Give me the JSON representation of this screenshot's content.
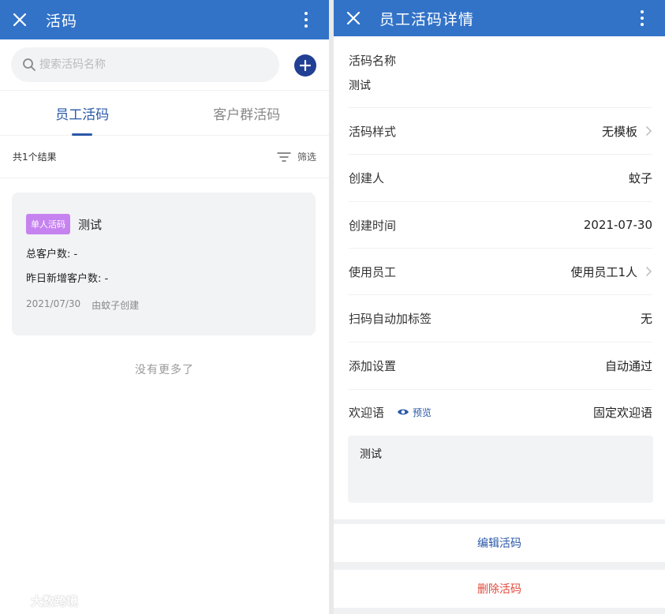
{
  "left": {
    "title": "活码",
    "search": {
      "placeholder": "搜索活码名称",
      "value": ""
    },
    "tabs": [
      {
        "label": "员工活码",
        "active": true
      },
      {
        "label": "客户群活码",
        "active": false
      }
    ],
    "result_count": "共1个结果",
    "filter_label": "筛选",
    "card": {
      "badge": "单人活码",
      "title": "测试",
      "total_customers": "总客户数: -",
      "new_customers": "昨日新增客户数: -",
      "date": "2021/07/30",
      "creator": "由蚊子创建"
    },
    "no_more": "没有更多了",
    "watermark": "大数跨境"
  },
  "right": {
    "title": "员工活码详情",
    "name_label": "活码名称",
    "name_value": "测试",
    "rows": [
      {
        "label": "活码样式",
        "value": "无模板"
      },
      {
        "label": "创建人",
        "value": "蚊子"
      },
      {
        "label": "创建时间",
        "value": "2021-07-30"
      },
      {
        "label": "使用员工",
        "value": "使用员工1人"
      },
      {
        "label": "扫码自动加标签",
        "value": "无"
      },
      {
        "label": "添加设置",
        "value": "自动通过"
      },
      {
        "label": "欢迎语",
        "value": "固定欢迎语"
      }
    ],
    "preview_label": "预览",
    "welcome_text": "测试",
    "edit_label": "编辑活码",
    "delete_label": "删除活码"
  },
  "colors": {
    "primary": "#3273c8",
    "accent": "#2a58a8",
    "badge": "#c683f0",
    "danger": "#e04a3b",
    "add": "#213f93"
  },
  "icons": [
    "close-icon",
    "more-vertical-icon",
    "search-icon",
    "plus-icon",
    "filter-icon",
    "chevron-right-icon",
    "eye-icon"
  ]
}
